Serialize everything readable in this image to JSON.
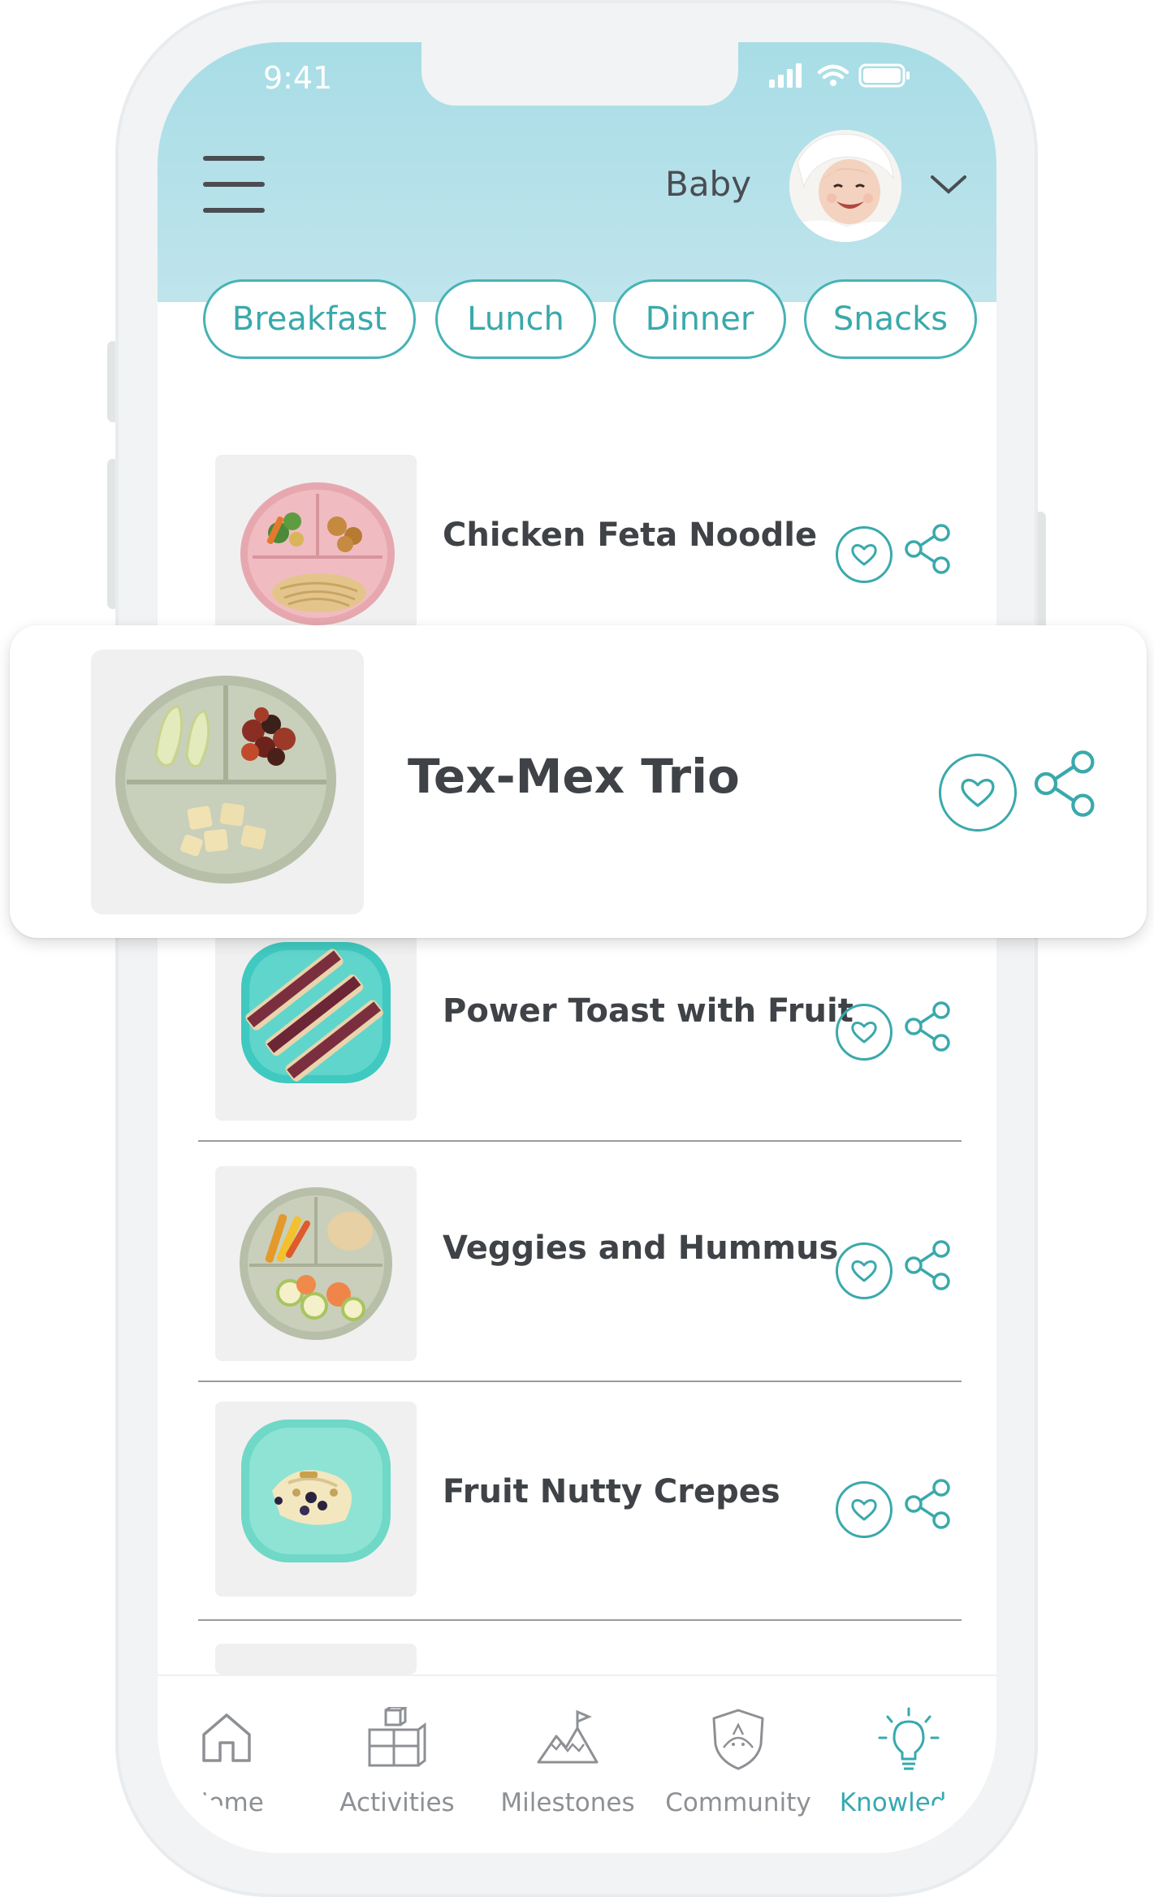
{
  "status_bar": {
    "time": "9:41"
  },
  "header": {
    "profile_name": "Baby"
  },
  "categories": [
    {
      "label": "Breakfast"
    },
    {
      "label": "Lunch"
    },
    {
      "label": "Dinner"
    },
    {
      "label": "Snacks"
    }
  ],
  "recipes": [
    {
      "title": "Chicken Feta Noodle"
    },
    {
      "title": "Power Toast with Fruit"
    },
    {
      "title": "Veggies and Hummus"
    },
    {
      "title": "Fruit Nutty Crepes"
    }
  ],
  "featured": {
    "title": "Tex-Mex Trio"
  },
  "tabs": [
    {
      "label": "Home",
      "icon": "home-icon"
    },
    {
      "label": "Activities",
      "icon": "blocks-icon"
    },
    {
      "label": "Milestones",
      "icon": "mountain-flag-icon"
    },
    {
      "label": "Community",
      "icon": "shield-face-icon"
    },
    {
      "label": "Knowledge",
      "icon": "lightbulb-icon",
      "active": true
    }
  ],
  "colors": {
    "accent": "#3aa9ab",
    "header_bg": "#b3e0e9",
    "text": "#3f4246",
    "frame": "#f1f3f4"
  }
}
